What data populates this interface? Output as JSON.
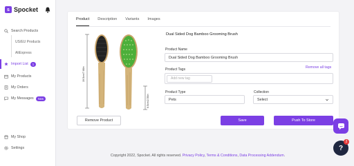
{
  "brand": {
    "name": "Spocket",
    "badge": "s"
  },
  "sidebar": {
    "items": [
      {
        "label": "Search Products",
        "icon": "search-icon"
      },
      {
        "label": "Import List",
        "icon": "star-icon",
        "badge": "1"
      },
      {
        "label": "My Products",
        "icon": "box-icon"
      },
      {
        "label": "My Orders",
        "icon": "orders-icon"
      },
      {
        "label": "My Messages",
        "icon": "chat-icon",
        "badge": "New"
      },
      {
        "label": "My Shop",
        "icon": "shop-icon"
      },
      {
        "label": "Settings",
        "icon": "gear-icon"
      }
    ],
    "sub_items": [
      "US/EU Products",
      "AliExpress"
    ]
  },
  "tabs": [
    "Product",
    "Description",
    "Variants",
    "Images"
  ],
  "product": {
    "title": "Dual Sided Dog Bamboo Grooming Brush",
    "dim_length": "19.5cm/7.68in",
    "dim_width": "6.5cm/2.56in"
  },
  "form": {
    "name_label": "Product Name",
    "name_value": "Dual Sided Dog Bamboo Grooming Brush",
    "tags_label": "Product Tags",
    "remove_tags": "Remove all tags",
    "tag_placeholder": "Add new tag",
    "type_label": "Product Type",
    "type_value": "Pets",
    "collection_label": "Collection",
    "collection_value": "Select"
  },
  "buttons": {
    "remove": "Remove Product",
    "save": "Save",
    "push": "Push To Store"
  },
  "footer": {
    "copyright": "Copyright 2022, Spocket. All rights reserved.",
    "privacy": "Privacy Policy",
    "terms": "Terms & Conditions",
    "dpa": "Data Processing Addendum"
  },
  "help": {
    "label": "?",
    "count": "2"
  },
  "colors": {
    "accent": "#7b3fe4",
    "help_bg": "#1f2740",
    "badge_red": "#e23a3a"
  }
}
